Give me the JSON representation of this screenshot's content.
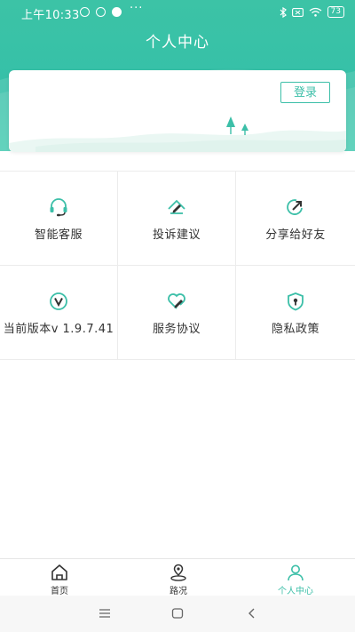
{
  "status_bar": {
    "time": "上午10:33",
    "dots": "···",
    "battery": "73"
  },
  "header": {
    "title": "个人中心"
  },
  "card": {
    "login_label": "登录"
  },
  "grid": [
    {
      "label": "智能客服",
      "icon": "headset-icon"
    },
    {
      "label": "投诉建议",
      "icon": "complaint-icon"
    },
    {
      "label": "分享给好友",
      "icon": "share-icon"
    },
    {
      "label": "当前版本v 1.9.7.41",
      "icon": "version-icon"
    },
    {
      "label": "服务协议",
      "icon": "agreement-icon"
    },
    {
      "label": "隐私政策",
      "icon": "privacy-shield-icon"
    }
  ],
  "tabs": [
    {
      "label": "首页",
      "icon": "home-icon"
    },
    {
      "label": "路况",
      "icon": "road-condition-icon"
    },
    {
      "label": "个人中心",
      "icon": "person-icon",
      "active": true
    }
  ],
  "colors": {
    "accent": "#3cbfa8",
    "header_bg": "#3cc3a6"
  }
}
